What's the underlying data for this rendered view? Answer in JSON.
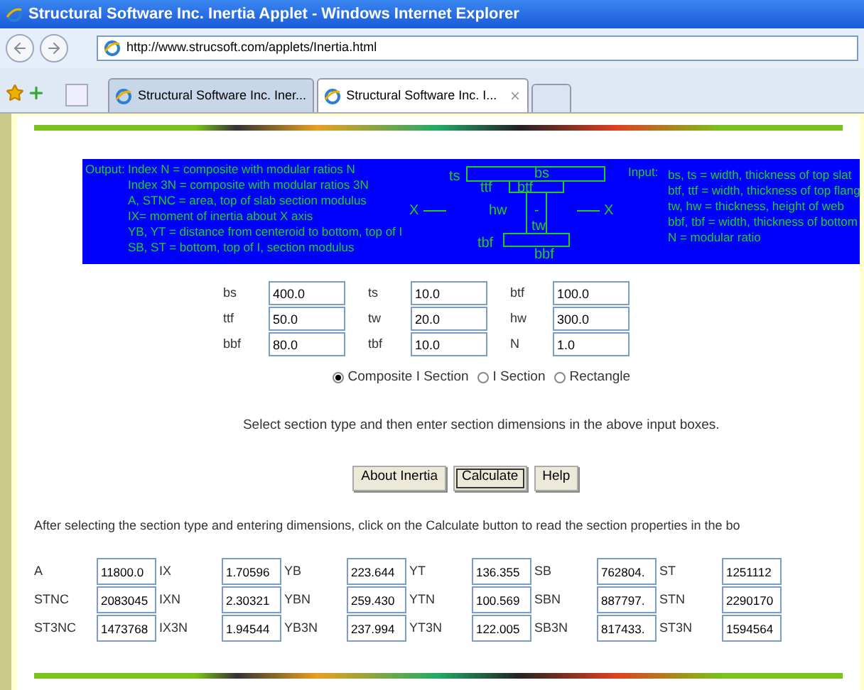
{
  "window": {
    "title": "Structural Software Inc. Inertia Applet - Windows Internet Explorer"
  },
  "address": "http://www.strucsoft.com/applets/Inertia.html",
  "tabs": [
    {
      "label": "Structural Software Inc. Iner...",
      "selected": false
    },
    {
      "label": "Structural Software Inc. I...",
      "selected": true
    }
  ],
  "legend": {
    "output_label": "Output:",
    "output_lines": [
      "Index N = composite with modular ratios N",
      "Index 3N = composite with modular ratios 3N",
      "A, STNC = area, top of slab section modulus",
      "IX=  moment of inertia about X axis",
      "YB, YT = distance from centeroid to bottom, top of I",
      "SB, ST = bottom, top of I, section modulus"
    ],
    "diagram_labels": {
      "ts": "ts",
      "bs": "bs",
      "ttf": "ttf",
      "btf": "btf",
      "x_left": "X",
      "hw": "hw",
      "dash": "-",
      "x_right": "X",
      "tw": "tw",
      "tbf": "tbf",
      "bbf": "bbf"
    },
    "input_label": "Input:",
    "input_lines": [
      "bs, ts = width, thickness of top slat",
      "btf, ttf = width, thickness of top flang",
      "tw, hw = thickness, height of web",
      "bbf, tbf = width, thickness of bottom",
      "N = modular ratio"
    ]
  },
  "inputs": [
    {
      "label": "bs",
      "value": "400.0"
    },
    {
      "label": "ts",
      "value": "10.0"
    },
    {
      "label": "btf",
      "value": "100.0"
    },
    {
      "label": "ttf",
      "value": "50.0"
    },
    {
      "label": "tw",
      "value": "20.0"
    },
    {
      "label": "hw",
      "value": "300.0"
    },
    {
      "label": "bbf",
      "value": "80.0"
    },
    {
      "label": "tbf",
      "value": "10.0"
    },
    {
      "label": "N",
      "value": "1.0"
    }
  ],
  "section_types": [
    {
      "label": "Composite I Section",
      "selected": true
    },
    {
      "label": "I Section",
      "selected": false
    },
    {
      "label": "Rectangle",
      "selected": false
    }
  ],
  "instruction": "Select section type and then enter section dimensions in the above input boxes.",
  "buttons": [
    {
      "label": "About Inertia",
      "focused": false
    },
    {
      "label": "Calculate",
      "focused": true
    },
    {
      "label": "Help",
      "focused": false
    }
  ],
  "result_note": "After selecting the section type and entering dimensions, click on the Calculate button to read the section properties in the bo",
  "outputs": [
    {
      "label": "A",
      "value": "11800.0"
    },
    {
      "label": "IX",
      "value": "1.70596"
    },
    {
      "label": "YB",
      "value": "223.644"
    },
    {
      "label": "YT",
      "value": "136.355"
    },
    {
      "label": "SB",
      "value": "762804."
    },
    {
      "label": "ST",
      "value": "1251112"
    },
    {
      "label": "STNC",
      "value": "2083045"
    },
    {
      "label": "IXN",
      "value": "2.30321"
    },
    {
      "label": "YBN",
      "value": "259.430"
    },
    {
      "label": "YTN",
      "value": "100.569"
    },
    {
      "label": "SBN",
      "value": "887797."
    },
    {
      "label": "STN",
      "value": "2290170"
    },
    {
      "label": "ST3NC",
      "value": "1473768"
    },
    {
      "label": "IX3N",
      "value": "1.94544"
    },
    {
      "label": "YB3N",
      "value": "237.994"
    },
    {
      "label": "YT3N",
      "value": "122.005"
    },
    {
      "label": "SB3N",
      "value": "817433."
    },
    {
      "label": "ST3N",
      "value": "1594564"
    }
  ]
}
